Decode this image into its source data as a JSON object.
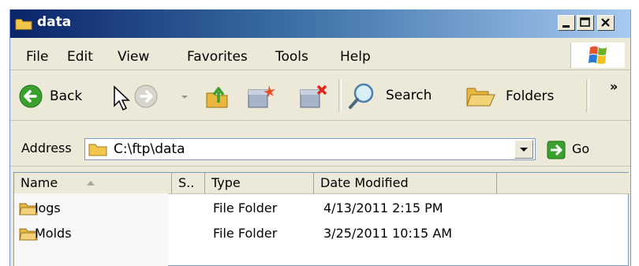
{
  "window": {
    "title": "data"
  },
  "menu": {
    "items": [
      "File",
      "Edit",
      "View",
      "Favorites",
      "Tools",
      "Help"
    ]
  },
  "toolbar": {
    "back_label": "Back",
    "search_label": "Search",
    "folders_label": "Folders",
    "more_label": "»"
  },
  "address": {
    "label": "Address",
    "value": "C:\\ftp\\data",
    "go_label": "Go"
  },
  "files": {
    "columns": [
      "Name",
      "S..",
      "Type",
      "Date Modified"
    ],
    "rows": [
      {
        "name": "logs",
        "type": "File Folder",
        "date": "4/13/2011 2:15 PM"
      },
      {
        "name": "Molds",
        "type": "File Folder",
        "date": "3/25/2011 10:15 AM"
      }
    ]
  },
  "colors": {
    "titlebar_start": "#0a246a",
    "titlebar_end": "#a6caf0",
    "window_face": "#ece9d8",
    "back_arrow": "#3aa02e",
    "folder": "#e6b84a"
  }
}
